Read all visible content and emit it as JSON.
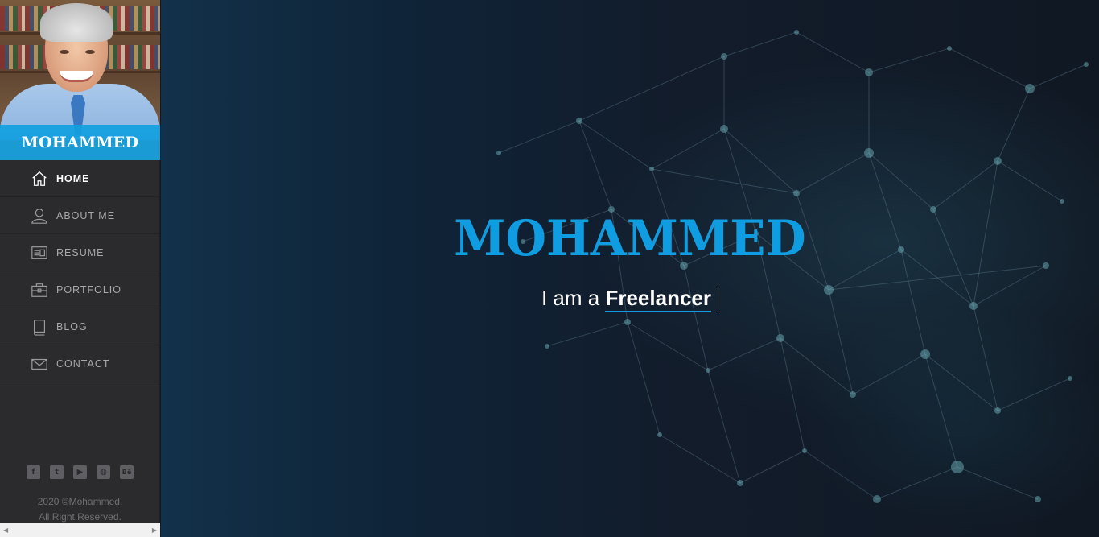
{
  "profile": {
    "name": "MOHAMMED"
  },
  "nav": {
    "items": [
      {
        "label": "HOME",
        "icon": "home-icon",
        "active": true
      },
      {
        "label": "ABOUT ME",
        "icon": "user-icon",
        "active": false
      },
      {
        "label": "RESUME",
        "icon": "resume-icon",
        "active": false
      },
      {
        "label": "PORTFOLIO",
        "icon": "briefcase-icon",
        "active": false
      },
      {
        "label": "BLOG",
        "icon": "book-icon",
        "active": false
      },
      {
        "label": "CONTACT",
        "icon": "envelope-icon",
        "active": false
      }
    ]
  },
  "socials": [
    {
      "name": "facebook-icon",
      "glyph": "f"
    },
    {
      "name": "twitter-icon",
      "glyph": "t"
    },
    {
      "name": "youtube-icon",
      "glyph": "▶"
    },
    {
      "name": "dribbble-icon",
      "glyph": "◍"
    },
    {
      "name": "behance-icon",
      "glyph": "Bē"
    }
  ],
  "footer": {
    "line1": "2020 ©Mohammed.",
    "line2": "All Right Reserved."
  },
  "hero": {
    "title": "MOHAMMED",
    "prefix": "I am a",
    "role": "Freelancer"
  },
  "colors": {
    "accent": "#0f9ce0",
    "sidebar": "#2b2b2e",
    "banner": "#11a0e0"
  }
}
